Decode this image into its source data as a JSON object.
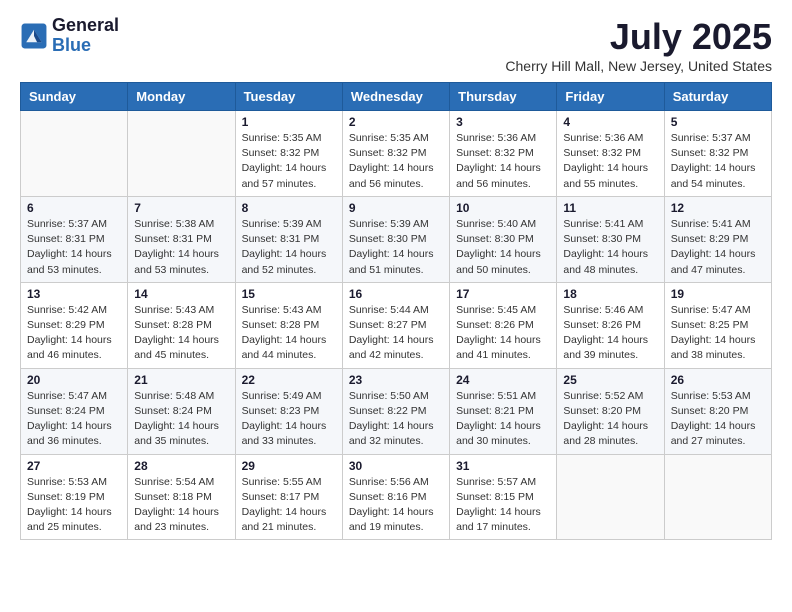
{
  "logo": {
    "general": "General",
    "blue": "Blue"
  },
  "title": "July 2025",
  "location": "Cherry Hill Mall, New Jersey, United States",
  "weekdays": [
    "Sunday",
    "Monday",
    "Tuesday",
    "Wednesday",
    "Thursday",
    "Friday",
    "Saturday"
  ],
  "weeks": [
    [
      {
        "day": "",
        "info": ""
      },
      {
        "day": "",
        "info": ""
      },
      {
        "day": "1",
        "info": "Sunrise: 5:35 AM\nSunset: 8:32 PM\nDaylight: 14 hours and 57 minutes."
      },
      {
        "day": "2",
        "info": "Sunrise: 5:35 AM\nSunset: 8:32 PM\nDaylight: 14 hours and 56 minutes."
      },
      {
        "day": "3",
        "info": "Sunrise: 5:36 AM\nSunset: 8:32 PM\nDaylight: 14 hours and 56 minutes."
      },
      {
        "day": "4",
        "info": "Sunrise: 5:36 AM\nSunset: 8:32 PM\nDaylight: 14 hours and 55 minutes."
      },
      {
        "day": "5",
        "info": "Sunrise: 5:37 AM\nSunset: 8:32 PM\nDaylight: 14 hours and 54 minutes."
      }
    ],
    [
      {
        "day": "6",
        "info": "Sunrise: 5:37 AM\nSunset: 8:31 PM\nDaylight: 14 hours and 53 minutes."
      },
      {
        "day": "7",
        "info": "Sunrise: 5:38 AM\nSunset: 8:31 PM\nDaylight: 14 hours and 53 minutes."
      },
      {
        "day": "8",
        "info": "Sunrise: 5:39 AM\nSunset: 8:31 PM\nDaylight: 14 hours and 52 minutes."
      },
      {
        "day": "9",
        "info": "Sunrise: 5:39 AM\nSunset: 8:30 PM\nDaylight: 14 hours and 51 minutes."
      },
      {
        "day": "10",
        "info": "Sunrise: 5:40 AM\nSunset: 8:30 PM\nDaylight: 14 hours and 50 minutes."
      },
      {
        "day": "11",
        "info": "Sunrise: 5:41 AM\nSunset: 8:30 PM\nDaylight: 14 hours and 48 minutes."
      },
      {
        "day": "12",
        "info": "Sunrise: 5:41 AM\nSunset: 8:29 PM\nDaylight: 14 hours and 47 minutes."
      }
    ],
    [
      {
        "day": "13",
        "info": "Sunrise: 5:42 AM\nSunset: 8:29 PM\nDaylight: 14 hours and 46 minutes."
      },
      {
        "day": "14",
        "info": "Sunrise: 5:43 AM\nSunset: 8:28 PM\nDaylight: 14 hours and 45 minutes."
      },
      {
        "day": "15",
        "info": "Sunrise: 5:43 AM\nSunset: 8:28 PM\nDaylight: 14 hours and 44 minutes."
      },
      {
        "day": "16",
        "info": "Sunrise: 5:44 AM\nSunset: 8:27 PM\nDaylight: 14 hours and 42 minutes."
      },
      {
        "day": "17",
        "info": "Sunrise: 5:45 AM\nSunset: 8:26 PM\nDaylight: 14 hours and 41 minutes."
      },
      {
        "day": "18",
        "info": "Sunrise: 5:46 AM\nSunset: 8:26 PM\nDaylight: 14 hours and 39 minutes."
      },
      {
        "day": "19",
        "info": "Sunrise: 5:47 AM\nSunset: 8:25 PM\nDaylight: 14 hours and 38 minutes."
      }
    ],
    [
      {
        "day": "20",
        "info": "Sunrise: 5:47 AM\nSunset: 8:24 PM\nDaylight: 14 hours and 36 minutes."
      },
      {
        "day": "21",
        "info": "Sunrise: 5:48 AM\nSunset: 8:24 PM\nDaylight: 14 hours and 35 minutes."
      },
      {
        "day": "22",
        "info": "Sunrise: 5:49 AM\nSunset: 8:23 PM\nDaylight: 14 hours and 33 minutes."
      },
      {
        "day": "23",
        "info": "Sunrise: 5:50 AM\nSunset: 8:22 PM\nDaylight: 14 hours and 32 minutes."
      },
      {
        "day": "24",
        "info": "Sunrise: 5:51 AM\nSunset: 8:21 PM\nDaylight: 14 hours and 30 minutes."
      },
      {
        "day": "25",
        "info": "Sunrise: 5:52 AM\nSunset: 8:20 PM\nDaylight: 14 hours and 28 minutes."
      },
      {
        "day": "26",
        "info": "Sunrise: 5:53 AM\nSunset: 8:20 PM\nDaylight: 14 hours and 27 minutes."
      }
    ],
    [
      {
        "day": "27",
        "info": "Sunrise: 5:53 AM\nSunset: 8:19 PM\nDaylight: 14 hours and 25 minutes."
      },
      {
        "day": "28",
        "info": "Sunrise: 5:54 AM\nSunset: 8:18 PM\nDaylight: 14 hours and 23 minutes."
      },
      {
        "day": "29",
        "info": "Sunrise: 5:55 AM\nSunset: 8:17 PM\nDaylight: 14 hours and 21 minutes."
      },
      {
        "day": "30",
        "info": "Sunrise: 5:56 AM\nSunset: 8:16 PM\nDaylight: 14 hours and 19 minutes."
      },
      {
        "day": "31",
        "info": "Sunrise: 5:57 AM\nSunset: 8:15 PM\nDaylight: 14 hours and 17 minutes."
      },
      {
        "day": "",
        "info": ""
      },
      {
        "day": "",
        "info": ""
      }
    ]
  ]
}
